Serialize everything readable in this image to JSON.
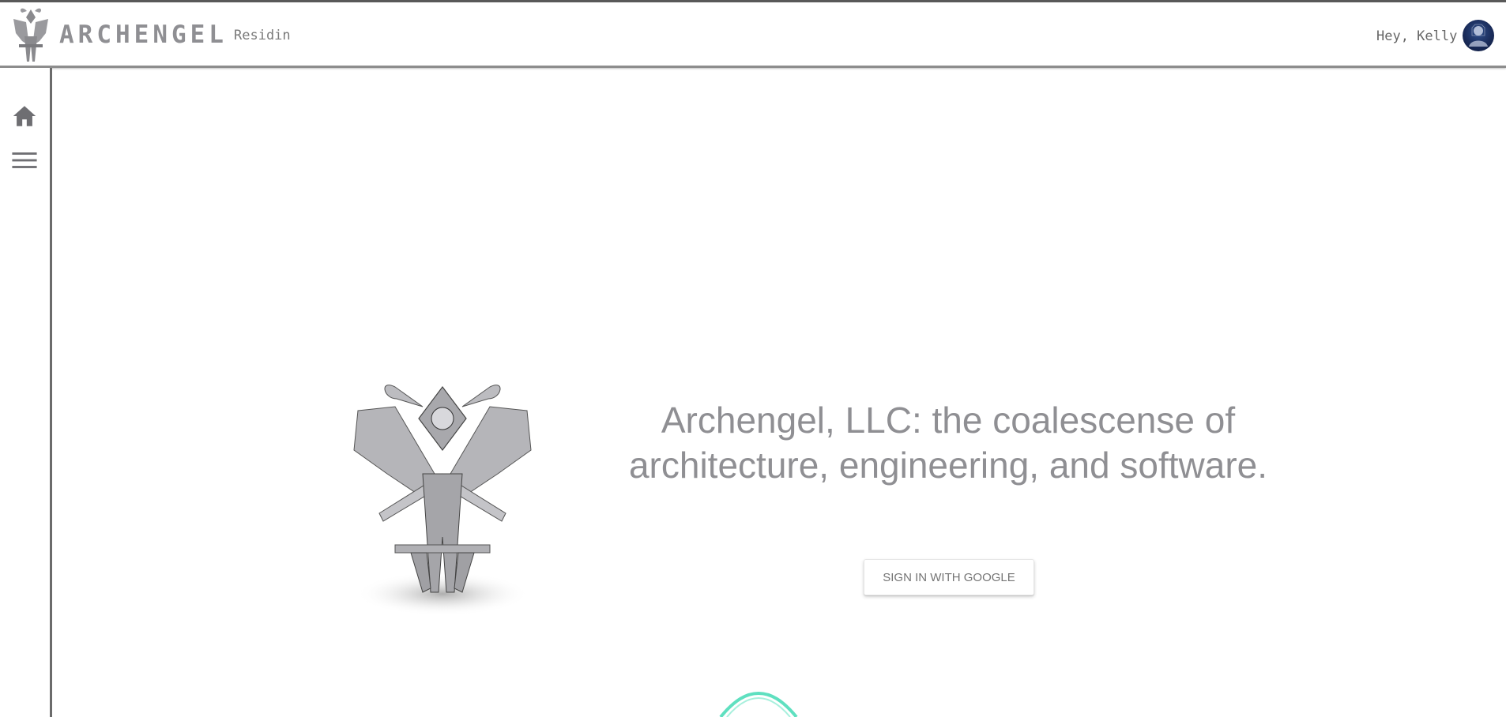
{
  "header": {
    "brand": "ARCHENGEL",
    "subbrand": "Residin",
    "greeting": "Hey, Kelly",
    "logo_icon": "archangel-logo-icon",
    "avatar_icon": "user-avatar"
  },
  "sidebar": {
    "items": [
      {
        "icon": "home-icon"
      },
      {
        "icon": "menu-icon"
      }
    ]
  },
  "hero": {
    "headline": "Archengel, LLC: the coalescense of architecture, engineering, and software.",
    "signin_label": "SIGN IN WITH GOOGLE"
  },
  "colors": {
    "text_gray": "#8f8f93",
    "icon_gray": "#6e6e72",
    "accent_mint": "#5fe0c0",
    "avatar_navy": "#1a2c5a"
  }
}
